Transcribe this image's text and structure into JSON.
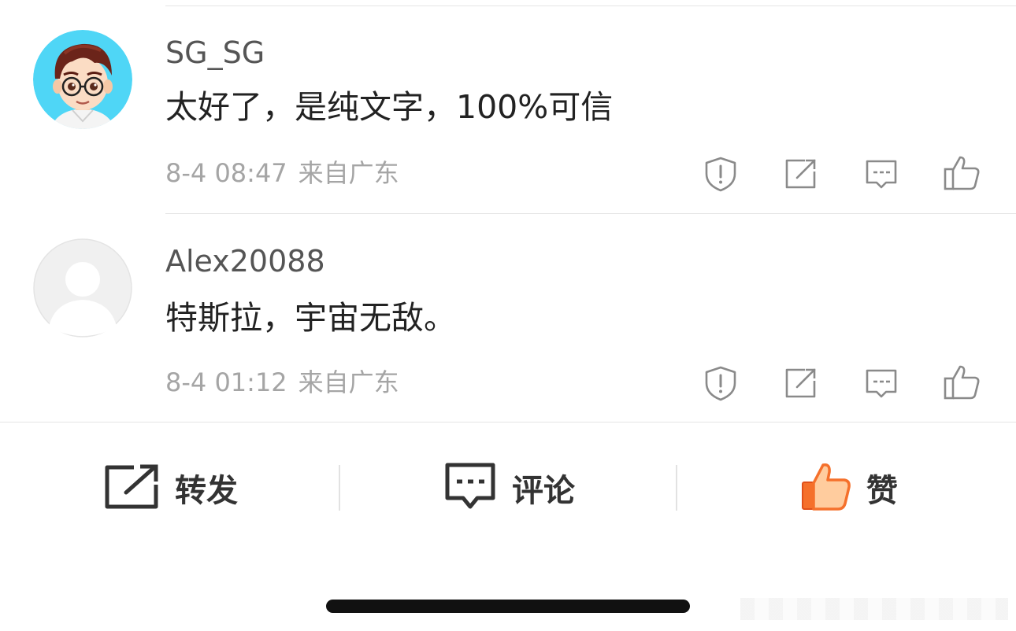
{
  "comments": [
    {
      "username": "SG_SG",
      "text": "太好了，是纯文字，100%可信",
      "time": "8-4 08:47",
      "location": "来自广东",
      "avatar": "cartoon-man-with-glasses-avatar"
    },
    {
      "username": "Alex20088",
      "text": "特斯拉，宇宙无敌。",
      "time": "8-4 01:12",
      "location": "来自广东",
      "avatar": "default-user-avatar"
    }
  ],
  "comment_icons": [
    "report-icon",
    "share-icon",
    "reply-icon",
    "like-icon"
  ],
  "bottom_bar": {
    "repost_label": "转发",
    "comment_label": "评论",
    "like_label": "赞"
  },
  "colors": {
    "like_accent": "#f5702b",
    "like_skin": "#ffcc9e",
    "text_primary": "#222222",
    "text_secondary": "#a5a5a5",
    "avatar_bg": "#4fd6f6"
  }
}
